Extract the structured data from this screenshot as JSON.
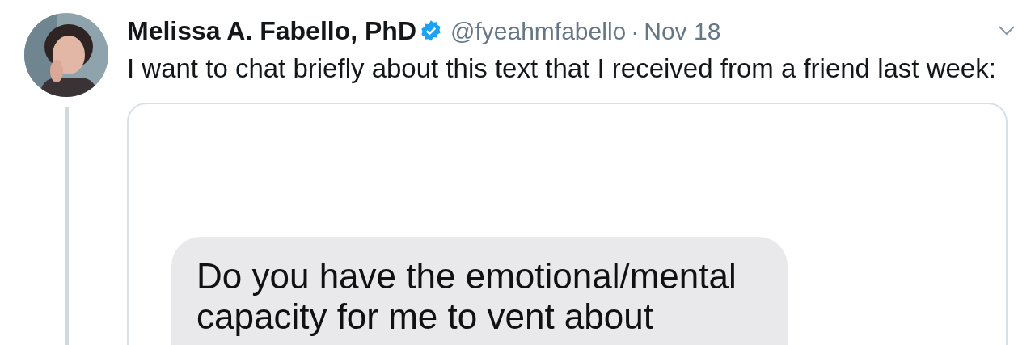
{
  "tweet": {
    "author": {
      "name": "Melissa A. Fabello, PhD",
      "verified": true,
      "handle": "@fyeahmfabello",
      "separator": "·",
      "date": "Nov 18"
    },
    "text": "I want to chat briefly about this text that I received from a friend last week:",
    "message": {
      "lines": [
        "Do you have the emotional/mental",
        "capacity for me to vent about"
      ]
    }
  }
}
